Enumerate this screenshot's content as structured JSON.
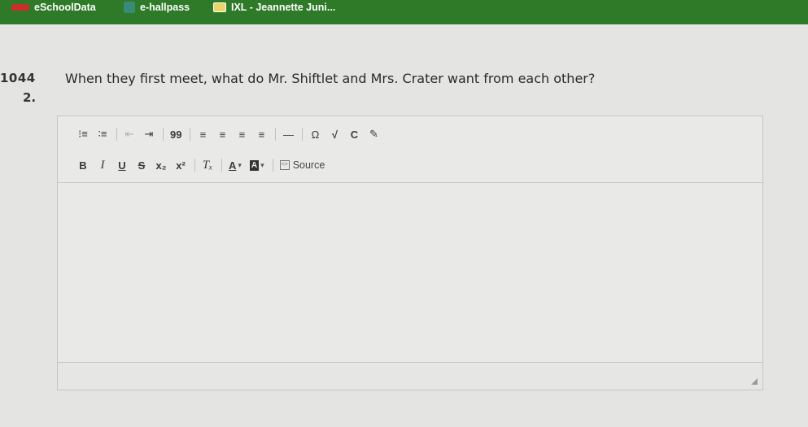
{
  "bookmarks": [
    {
      "label": "eSchoolData",
      "icon": "eschooldata-icon"
    },
    {
      "label": "e-hallpass",
      "icon": "hallpass-icon"
    },
    {
      "label": "IXL - Jeannette Juni...",
      "icon": "ixl-icon"
    }
  ],
  "question": {
    "number_line1": "1044",
    "number_line2": "2.",
    "text": "When they first meet, what do Mr. Shiftlet and Mrs. Crater want from each other?"
  },
  "editor": {
    "toolbar_row1": {
      "numbered_list": "⁝≡",
      "bulleted_list": "∶≡",
      "decrease_indent": "⇤",
      "increase_indent": "⇥",
      "blockquote": "99",
      "align_left": "≡",
      "align_center": "≡",
      "align_right": "≡",
      "justify": "≡",
      "horizontal_rule": "—",
      "special_char": "Ω",
      "math": "√",
      "chemistry": "C",
      "draw": "✎"
    },
    "toolbar_row2": {
      "bold": "B",
      "italic": "I",
      "underline": "U",
      "strike": "S",
      "subscript": "x₂",
      "superscript": "x²",
      "remove_format": "Tₓ",
      "text_color": "A",
      "bg_color": "A",
      "source_label": "Source"
    },
    "content": ""
  },
  "colors": {
    "bookmarks_bar": "#2e7a28",
    "page_bg": "#e4e4e2",
    "editor_border": "#c5c6c2"
  }
}
